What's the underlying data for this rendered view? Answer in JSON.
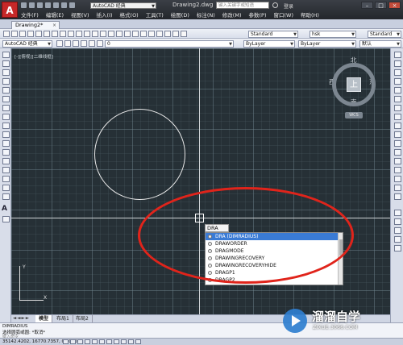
{
  "titlebar": {
    "logo": "A",
    "workspace": "AutoCAD 经典",
    "doc_title": "Drawing2.dwg",
    "search_placeholder": "键入关键字或短语",
    "login": "登录",
    "menus": [
      "文件(F)",
      "编辑(E)",
      "视图(V)",
      "插入(I)",
      "格式(O)",
      "工具(T)",
      "绘图(D)",
      "标注(N)",
      "修改(M)",
      "参数(P)",
      "窗口(W)",
      "帮助(H)"
    ]
  },
  "tabbar": {
    "doc_tab": "Drawing2*"
  },
  "toolbar": {
    "text_style": "Standard",
    "dim_style": "hsk",
    "table_style": "Standard",
    "workspace2": "AutoCAD 经典",
    "layer": "0",
    "color": "ByLayer",
    "linetype": "ByLayer",
    "lineweight": "默认"
  },
  "canvas": {
    "view_label": "[-][俯视][二维线框]",
    "viewcube": {
      "north": "北",
      "south": "南",
      "east": "东",
      "west": "西",
      "face": "上",
      "wcs": "WCS"
    },
    "ucs": {
      "x": "X",
      "y": "Y"
    }
  },
  "autocomplete": {
    "typed": "DRA",
    "items": [
      {
        "label": "DRA (DIMRADIUS)",
        "selected": true
      },
      {
        "label": "DRAWORDER",
        "selected": false
      },
      {
        "label": "DRAGMODE",
        "selected": false
      },
      {
        "label": "DRAWINGRECOVERY",
        "selected": false
      },
      {
        "label": "DRAWINGRECOVERYHIDE",
        "selected": false
      },
      {
        "label": "DRAGP1",
        "selected": false
      },
      {
        "label": "DRAGP2",
        "selected": false
      }
    ]
  },
  "layout_tabs": {
    "nav": "◄◄►►",
    "model": "模型",
    "layout1": "布局1",
    "layout2": "布局2"
  },
  "command": {
    "line1": "DIMRADIUS",
    "line2": "选择圆弧或圆: *取消*",
    "prompt": "键入命令"
  },
  "status": {
    "coords": "35142.4202, 16770.7357, 0.0000"
  },
  "watermark": {
    "text": "溜溜自学",
    "url": "ZIXUE.3066.COM"
  },
  "colors": {
    "canvas_bg": "#263036",
    "annotation": "#e0241b",
    "selected": "#3a7bd5"
  }
}
